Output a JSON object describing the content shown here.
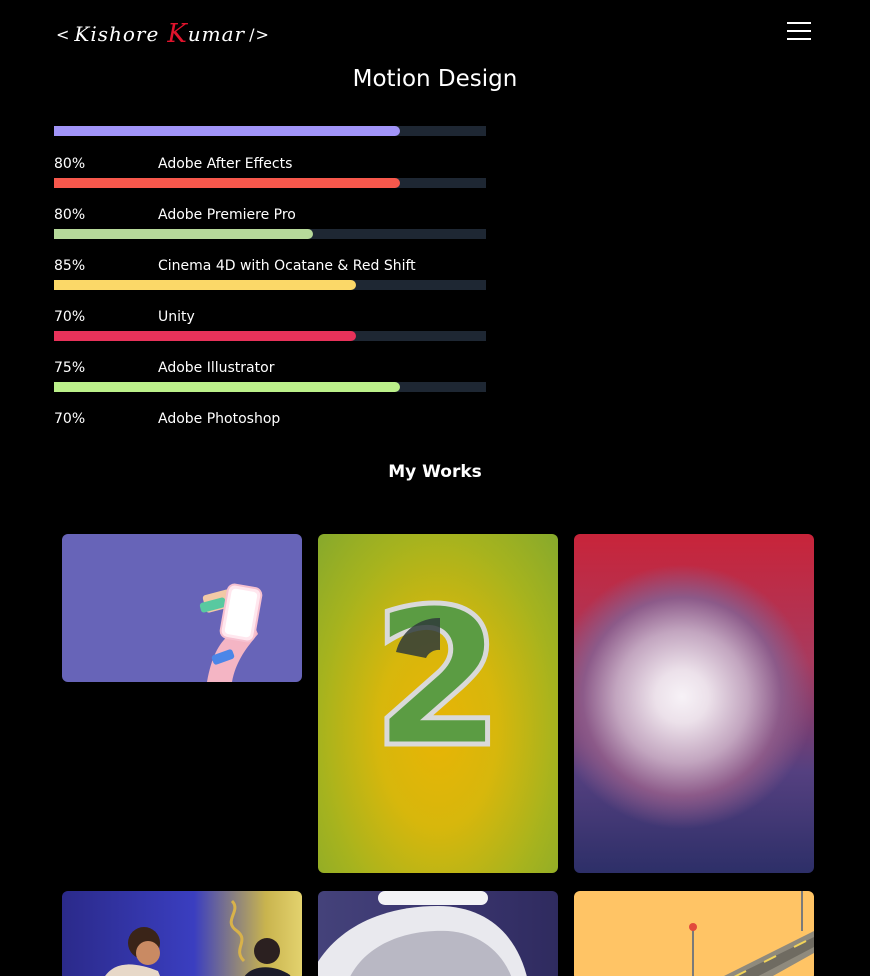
{
  "header": {
    "logo": {
      "open": "<",
      "first": "Kishore",
      "initial": "K",
      "rest": "umar",
      "close": "/>"
    }
  },
  "motion_section": {
    "title": "Motion Design",
    "skills": [
      {
        "percent_label": "80%",
        "name": "Adobe After Effects",
        "level": 0.8,
        "color": "#a194f8"
      },
      {
        "percent_label": "80%",
        "name": "Adobe Premiere Pro",
        "level": 0.8,
        "color": "#f7584c"
      },
      {
        "percent_label": "85%",
        "name": "Cinema 4D with Ocatane & Red Shift",
        "level": 0.6,
        "color": "#b6d99a"
      },
      {
        "percent_label": "70%",
        "name": "Unity",
        "level": 0.7,
        "color": "#fbd868"
      },
      {
        "percent_label": "75%",
        "name": "Adobe Illustrator",
        "level": 0.7,
        "color": "#e8325a"
      },
      {
        "percent_label": "70%",
        "name": "Adobe Photoshop",
        "level": 0.8,
        "color": "#bbf08a"
      }
    ]
  },
  "works_section": {
    "title": "My Works"
  },
  "colors": {
    "background": "#000000",
    "track": "#1e2733",
    "logo_accent": "#e0132c"
  }
}
